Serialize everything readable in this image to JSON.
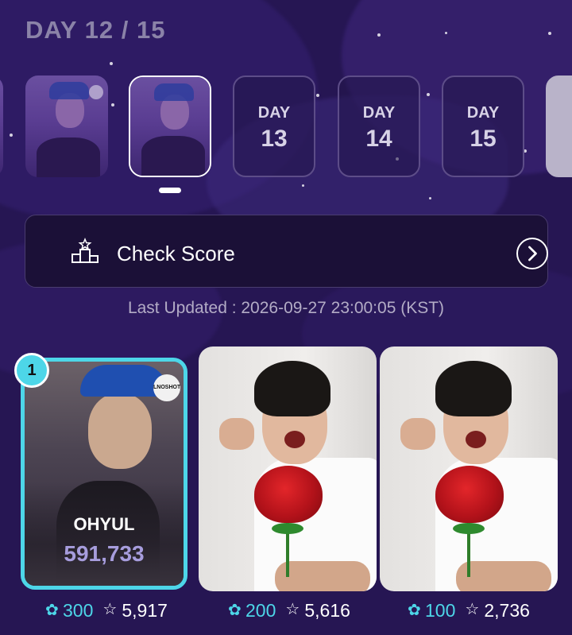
{
  "header": {
    "title": "DAY 12 / 15"
  },
  "days": [
    {
      "label": "DAY",
      "number": "13"
    },
    {
      "label": "DAY",
      "number": "14"
    },
    {
      "label": "DAY",
      "number": "15"
    }
  ],
  "score_button": {
    "label": "Check Score",
    "icon": "podium-icon",
    "action_icon": "chevron-right-icon"
  },
  "last_updated": "Last Updated : 2026-09-27 23:00:05 (KST)",
  "cards": [
    {
      "rank": "1",
      "name": "OHYUL",
      "score": "591,733",
      "logo_text": "LNOSHOT",
      "tickets": "300",
      "stars": "5,917"
    },
    {
      "tickets": "200",
      "stars": "5,616"
    },
    {
      "tickets": "100",
      "stars": "2,736"
    }
  ],
  "colors": {
    "accent": "#4dd6e8",
    "background": "#261653",
    "score": "#a79ddd"
  }
}
